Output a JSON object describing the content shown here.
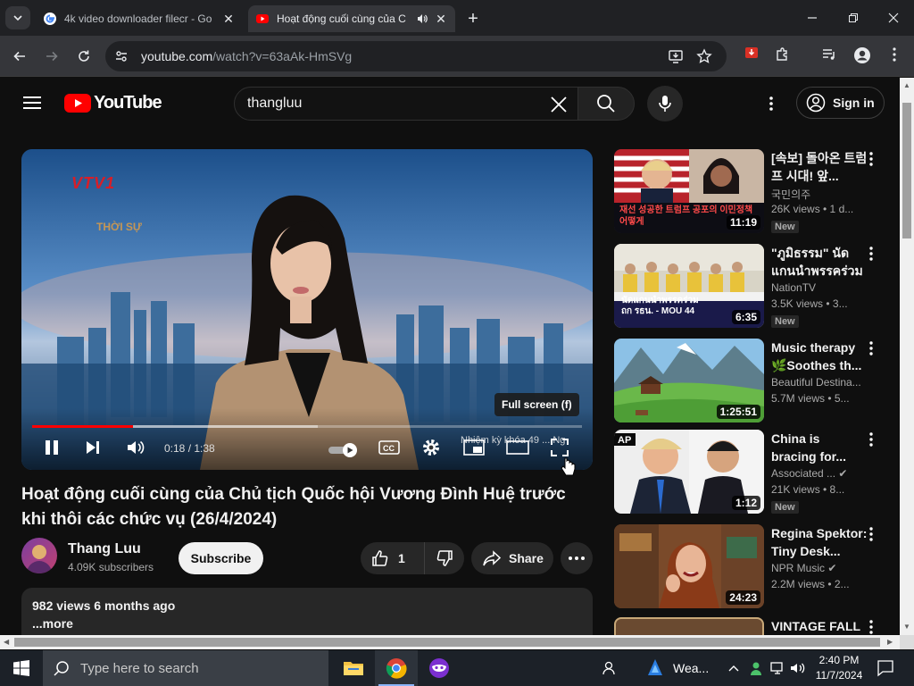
{
  "browser": {
    "tabs": [
      {
        "title": "4k video downloader filecr - Go",
        "active": false
      },
      {
        "title": "Hoạt động cuối cùng của C",
        "active": true
      }
    ],
    "url_host": "youtube.com",
    "url_path": "/watch?v=63aAk-HmSVg",
    "extension_badge": "51"
  },
  "youtube": {
    "logo_text": "YouTube",
    "search_value": "thangluu",
    "sign_in_label": "Sign in",
    "player": {
      "channel_logo": "VTV1",
      "program_logo": "THỜI SỰ",
      "tooltip": "Full screen (f)",
      "time_display": "0:18 / 1:38",
      "chapter_text": "Nhiệm kỳ khóa 49 ... Ng",
      "progress_played": 0.183,
      "progress_loaded": 0.52
    },
    "video": {
      "title": "Hoạt động cuối cùng của Chủ tịch Quốc hội Vương Đình Huệ trước khi thôi các chức vụ (26/4/2024)",
      "channel": "Thang Luu",
      "subscribers": "4.09K subscribers",
      "subscribe_label": "Subscribe",
      "likes": "1",
      "share_label": "Share",
      "stats": "982 views  6 months ago",
      "more_label": "...more"
    },
    "recommendations": [
      {
        "title": "[속보] 돌아온 트럼프 시대! 앞...",
        "channel": "국민의주",
        "meta": "26K views • 1 d...",
        "duration": "11:19",
        "badge": "New",
        "thumb_text": "재선 성공한 트럼프 공포의 이민정책 어떻게"
      },
      {
        "title": "\"ภูมิธรรม\" นัดแกนนำพรรคร่วมถก...",
        "channel": "NationTV",
        "meta": "3.5K views • 3...",
        "duration": "6:35",
        "badge": "New",
        "thumb_text": "นัดแกนนำพรรคร่วม ถก รธน. - MOU 44"
      },
      {
        "title": "Music therapy 🌿Soothes th...",
        "channel": "Beautiful Destina...",
        "meta": "5.7M views • 5...",
        "duration": "1:25:51",
        "badge": "",
        "thumb_text": ""
      },
      {
        "title": "China is bracing for...",
        "channel": "Associated ...",
        "meta": "21K views • 8...",
        "duration": "1:12",
        "badge": "New",
        "thumb_text": "AP"
      },
      {
        "title": "Regina Spektor: Tiny Desk...",
        "channel": "NPR Music",
        "meta": "2.2M views • 2...",
        "duration": "24:23",
        "badge": "",
        "thumb_text": ""
      },
      {
        "title": "VINTAGE FALL",
        "channel": "",
        "meta": "",
        "duration": "",
        "badge": "",
        "thumb_text": ""
      }
    ]
  },
  "taskbar": {
    "search_placeholder": "Type here to search",
    "weather": "Wea...",
    "time": "2:40 PM",
    "date": "11/7/2024"
  },
  "colors": {
    "yt_red": "#ff0000",
    "bg": "#0f0f0f",
    "chrome_dark": "#202124"
  }
}
